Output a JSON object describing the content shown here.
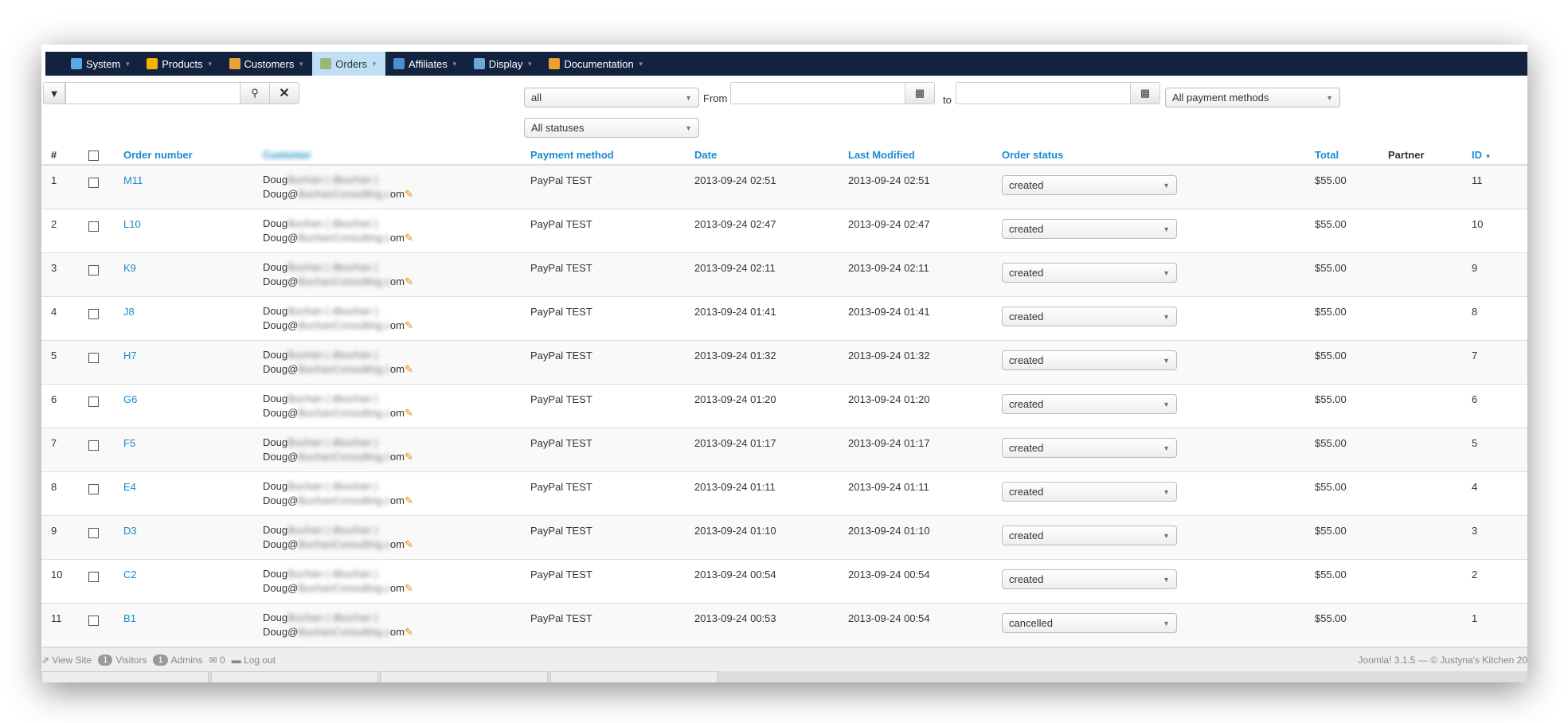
{
  "menu": [
    {
      "label": "System",
      "icon": "tools-icon",
      "color": "#5aa9e6"
    },
    {
      "label": "Products",
      "icon": "box-icon",
      "color": "#f5b400"
    },
    {
      "label": "Customers",
      "icon": "users-icon",
      "color": "#e8a23a"
    },
    {
      "label": "Orders",
      "icon": "orders-icon",
      "color": "#9ab77a",
      "active": true
    },
    {
      "label": "Affiliates",
      "icon": "affiliates-icon",
      "color": "#4a8fd0"
    },
    {
      "label": "Display",
      "icon": "display-icon",
      "color": "#6aa8d8"
    },
    {
      "label": "Documentation",
      "icon": "lifebuoy-icon",
      "color": "#f0a030"
    }
  ],
  "filters": {
    "search_value": "",
    "date_type": "all",
    "from_label": "From",
    "to_label": "to",
    "from_value": "",
    "to_value": "",
    "payment": "All payment methods",
    "status": "All statuses"
  },
  "columns": {
    "num": "#",
    "order_number": "Order number",
    "customer": "Customer",
    "payment": "Payment method",
    "date": "Date",
    "modified": "Last Modified",
    "status": "Order status",
    "total": "Total",
    "partner": "Partner",
    "id": "ID"
  },
  "rows": [
    {
      "n": "1",
      "order": "M11",
      "first": "Doug",
      "name_rest": "Buchan ( dbuchan )",
      "email_a": "Doug@",
      "email_b": "BuchanConsulting.c",
      "email_c": "om",
      "payment": "PayPal TEST",
      "date": "2013-09-24 02:51",
      "modified": "2013-09-24 02:51",
      "status": "created",
      "total": "$55.00",
      "id": "11"
    },
    {
      "n": "2",
      "order": "L10",
      "first": "Doug",
      "name_rest": "Buchan ( dbuchan )",
      "email_a": "Doug@",
      "email_b": "BuchanConsulting.c",
      "email_c": "om",
      "payment": "PayPal TEST",
      "date": "2013-09-24 02:47",
      "modified": "2013-09-24 02:47",
      "status": "created",
      "total": "$55.00",
      "id": "10"
    },
    {
      "n": "3",
      "order": "K9",
      "first": "Doug",
      "name_rest": "Buchan ( dbuchan )",
      "email_a": "Doug@",
      "email_b": "BuchanConsulting.c",
      "email_c": "om",
      "payment": "PayPal TEST",
      "date": "2013-09-24 02:11",
      "modified": "2013-09-24 02:11",
      "status": "created",
      "total": "$55.00",
      "id": "9"
    },
    {
      "n": "4",
      "order": "J8",
      "first": "Doug",
      "name_rest": "Buchan ( dbuchan )",
      "email_a": "Doug@",
      "email_b": "BuchanConsulting.c",
      "email_c": "om",
      "payment": "PayPal TEST",
      "date": "2013-09-24 01:41",
      "modified": "2013-09-24 01:41",
      "status": "created",
      "total": "$55.00",
      "id": "8"
    },
    {
      "n": "5",
      "order": "H7",
      "first": "Doug",
      "name_rest": "Buchan ( dbuchan )",
      "email_a": "Doug@",
      "email_b": "BuchanConsulting.c",
      "email_c": "om",
      "payment": "PayPal TEST",
      "date": "2013-09-24 01:32",
      "modified": "2013-09-24 01:32",
      "status": "created",
      "total": "$55.00",
      "id": "7"
    },
    {
      "n": "6",
      "order": "G6",
      "first": "Doug",
      "name_rest": "Buchan ( dbuchan )",
      "email_a": "Doug@",
      "email_b": "BuchanConsulting.c",
      "email_c": "om",
      "payment": "PayPal TEST",
      "date": "2013-09-24 01:20",
      "modified": "2013-09-24 01:20",
      "status": "created",
      "total": "$55.00",
      "id": "6"
    },
    {
      "n": "7",
      "order": "F5",
      "first": "Doug",
      "name_rest": "Buchan ( dbuchan )",
      "email_a": "Doug@",
      "email_b": "BuchanConsulting.c",
      "email_c": "om",
      "payment": "PayPal TEST",
      "date": "2013-09-24 01:17",
      "modified": "2013-09-24 01:17",
      "status": "created",
      "total": "$55.00",
      "id": "5"
    },
    {
      "n": "8",
      "order": "E4",
      "first": "Doug",
      "name_rest": "Buchan ( dbuchan )",
      "email_a": "Doug@",
      "email_b": "BuchanConsulting.c",
      "email_c": "om",
      "payment": "PayPal TEST",
      "date": "2013-09-24 01:11",
      "modified": "2013-09-24 01:11",
      "status": "created",
      "total": "$55.00",
      "id": "4"
    },
    {
      "n": "9",
      "order": "D3",
      "first": "Doug",
      "name_rest": "Buchan ( dbuchan )",
      "email_a": "Doug@",
      "email_b": "BuchanConsulting.c",
      "email_c": "om",
      "payment": "PayPal TEST",
      "date": "2013-09-24 01:10",
      "modified": "2013-09-24 01:10",
      "status": "created",
      "total": "$55.00",
      "id": "3"
    },
    {
      "n": "10",
      "order": "C2",
      "first": "Doug",
      "name_rest": "Buchan ( dbuchan )",
      "email_a": "Doug@",
      "email_b": "BuchanConsulting.c",
      "email_c": "om",
      "payment": "PayPal TEST",
      "date": "2013-09-24 00:54",
      "modified": "2013-09-24 00:54",
      "status": "created",
      "total": "$55.00",
      "id": "2"
    },
    {
      "n": "11",
      "order": "B1",
      "first": "Doug",
      "name_rest": "Buchan ( dbuchan )",
      "email_a": "Doug@",
      "email_b": "BuchanConsulting.c",
      "email_c": "om",
      "payment": "PayPal TEST",
      "date": "2013-09-24 00:53",
      "modified": "2013-09-24 00:54",
      "status": "cancelled",
      "total": "$55.00",
      "id": "1"
    }
  ],
  "footer": {
    "view_site": "View Site",
    "visitors_count": "1",
    "visitors": "Visitors",
    "admins_count": "1",
    "admins": "Admins",
    "messages": "0",
    "logout": "Log out",
    "version": "Joomla! 3.1.5 — © Justyna's Kitchen 20"
  }
}
